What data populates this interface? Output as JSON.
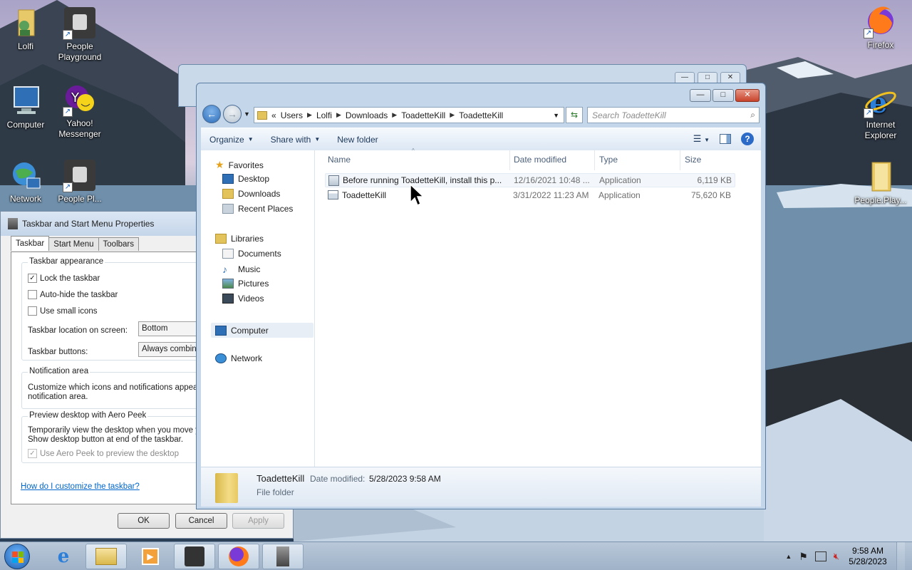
{
  "desktop": {
    "icons": [
      {
        "label": "Lolfi"
      },
      {
        "label": "People Playground"
      },
      {
        "label": "Computer"
      },
      {
        "label": "Yahoo! Messenger"
      },
      {
        "label": "Network"
      },
      {
        "label": "People Pl..."
      },
      {
        "label": "Firefox"
      },
      {
        "label": "Internet Explorer"
      },
      {
        "label": "People.Play..."
      }
    ]
  },
  "props": {
    "title": "Taskbar and Start Menu Properties",
    "tabs": [
      "Taskbar",
      "Start Menu",
      "Toolbars"
    ],
    "group_appearance": "Taskbar appearance",
    "lock": "Lock the taskbar",
    "autohide": "Auto-hide the taskbar",
    "small_icons": "Use small icons",
    "location_label": "Taskbar location on screen:",
    "location_value": "Bottom",
    "buttons_label": "Taskbar buttons:",
    "buttons_value": "Always combine",
    "group_notification": "Notification area",
    "notification_desc": "Customize which icons and notifications appear in notification area.",
    "group_peek": "Preview desktop with Aero Peek",
    "peek_desc": "Temporarily view the desktop when you move you Show desktop button at end of the taskbar.",
    "peek_check": "Use Aero Peek to preview the desktop",
    "help_link": "How do I customize the taskbar?",
    "ok": "OK",
    "cancel": "Cancel",
    "apply": "Apply"
  },
  "explorer": {
    "breadcrumb": [
      "«",
      "Users",
      "Lolfi",
      "Downloads",
      "ToadetteKill",
      "ToadetteKill"
    ],
    "search_placeholder": "Search ToadetteKill",
    "cmd": {
      "organize": "Organize",
      "share": "Share with",
      "new_folder": "New folder"
    },
    "nav": {
      "favorites": "Favorites",
      "desktop": "Desktop",
      "downloads": "Downloads",
      "recent": "Recent Places",
      "libraries": "Libraries",
      "documents": "Documents",
      "music": "Music",
      "pictures": "Pictures",
      "videos": "Videos",
      "computer": "Computer",
      "network": "Network"
    },
    "columns": {
      "name": "Name",
      "date": "Date modified",
      "type": "Type",
      "size": "Size"
    },
    "files": [
      {
        "name": "Before running ToadetteKill, install this p...",
        "date": "12/16/2021 10:48 ...",
        "type": "Application",
        "size": "6,119 KB"
      },
      {
        "name": "ToadetteKill",
        "date": "3/31/2022 11:23 AM",
        "type": "Application",
        "size": "75,620 KB"
      }
    ],
    "details": {
      "name": "ToadetteKill",
      "date_label": "Date modified:",
      "date_value": "5/28/2023 9:58 AM",
      "type": "File folder"
    }
  },
  "taskbar": {
    "time": "9:58 AM",
    "date": "5/28/2023"
  }
}
